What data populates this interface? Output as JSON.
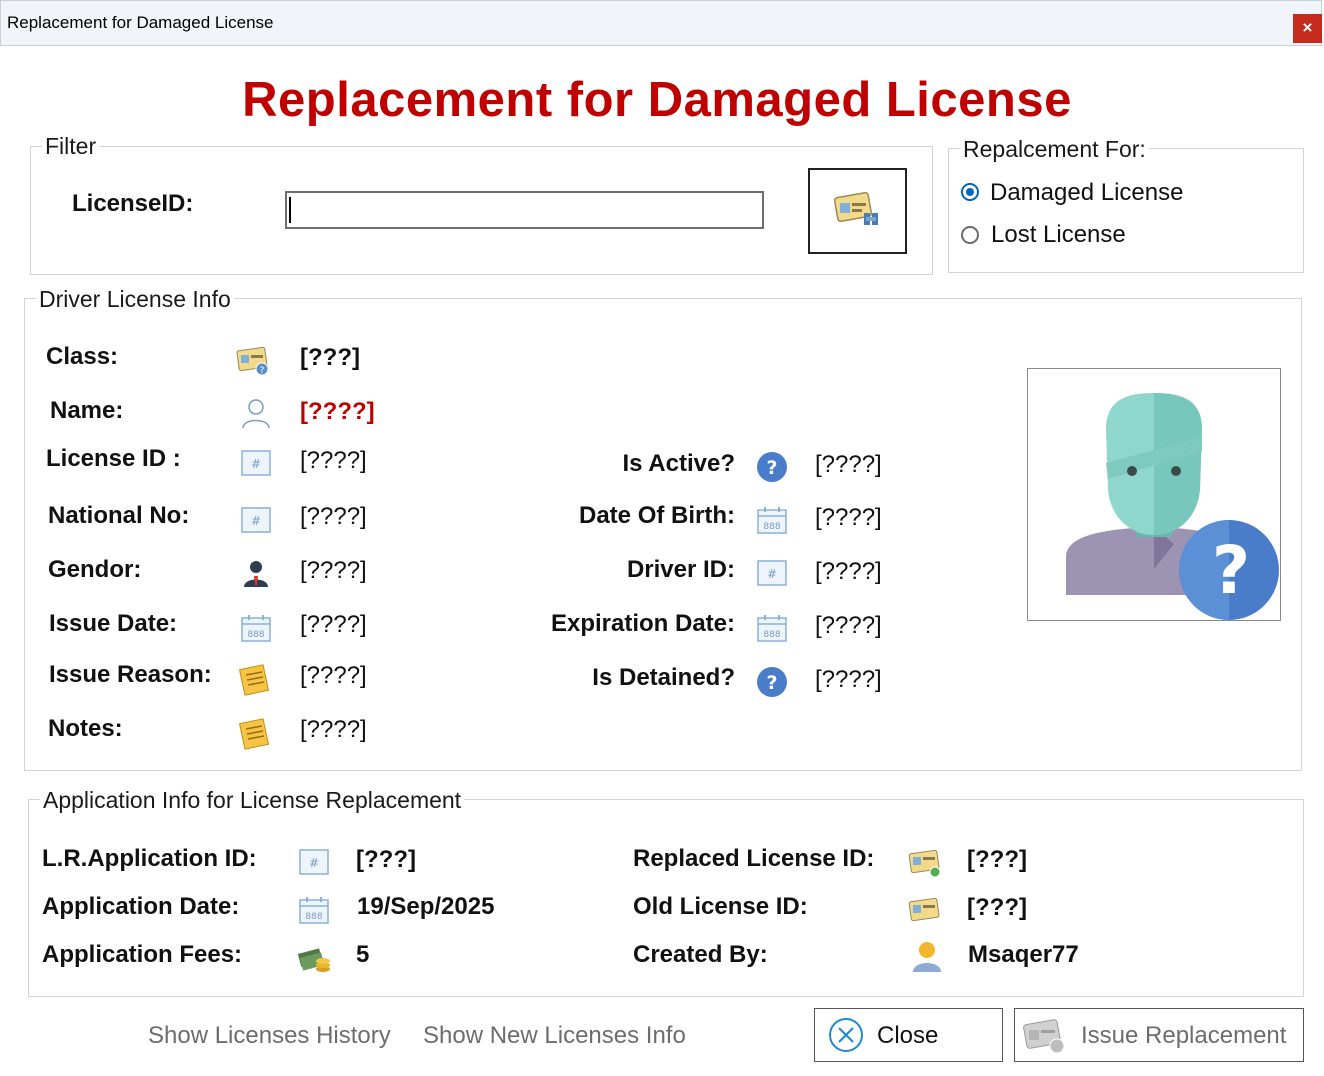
{
  "window": {
    "title": "Replacement for Damaged License",
    "close_glyph": "×"
  },
  "heading": "Replacement for Damaged License",
  "filter": {
    "legend": "Filter",
    "license_id_label": "LicenseID:",
    "license_id_value": "",
    "search_icon": "license-card-search-icon"
  },
  "replacement_for": {
    "legend": "Repalcement For:",
    "options": [
      {
        "label": "Damaged License",
        "selected": true
      },
      {
        "label": "Lost License",
        "selected": false
      }
    ]
  },
  "driver_info": {
    "legend": "Driver License Info",
    "left_rows": [
      {
        "label": "Class:",
        "icon": "license-class-icon",
        "value": "[???]"
      },
      {
        "label": "Name:",
        "icon": "person-outline-icon",
        "value": "[????]"
      },
      {
        "label": "License ID :",
        "icon": "id-number-icon",
        "value": "[????]"
      },
      {
        "label": "National No:",
        "icon": "id-number-icon",
        "value": "[????]"
      },
      {
        "label": "Gendor:",
        "icon": "gender-person-icon",
        "value": "[????]"
      },
      {
        "label": "Issue Date:",
        "icon": "calendar-icon",
        "value": "[????]"
      },
      {
        "label": "Issue Reason:",
        "icon": "notepad-icon",
        "value": "[????]"
      },
      {
        "label": "Notes:",
        "icon": "notepad-icon",
        "value": "[????]"
      }
    ],
    "right_rows": [
      {
        "label": "Is Active?",
        "icon": "question-circle-icon",
        "value": "[????]"
      },
      {
        "label": "Date Of Birth:",
        "icon": "calendar-icon",
        "value": "[????]"
      },
      {
        "label": "Driver ID:",
        "icon": "id-number-icon",
        "value": "[????]"
      },
      {
        "label": "Expiration Date:",
        "icon": "calendar-icon",
        "value": "[????]"
      },
      {
        "label": "Is Detained?",
        "icon": "question-circle-icon",
        "value": "[????]"
      }
    ],
    "photo_icon": "unknown-person-photo-icon"
  },
  "application_info": {
    "legend": "Application Info for License Replacement",
    "left_rows": [
      {
        "label": "L.R.Application ID:",
        "icon": "id-number-icon",
        "value": "[???]"
      },
      {
        "label": "Application Date:",
        "icon": "calendar-icon",
        "value": "19/Sep/2025"
      },
      {
        "label": "Application Fees:",
        "icon": "money-coins-icon",
        "value": "5"
      }
    ],
    "right_rows": [
      {
        "label": "Replaced License ID:",
        "icon": "license-card-new-icon",
        "value": "[???]"
      },
      {
        "label": "Old License ID:",
        "icon": "license-card-icon",
        "value": "[???]"
      },
      {
        "label": "Created By:",
        "icon": "user-avatar-icon",
        "value": "Msaqer77"
      }
    ]
  },
  "footer": {
    "show_history_link": "Show Licenses History",
    "show_new_info_link": "Show New Licenses Info",
    "close_button": "Close",
    "issue_button": "Issue Replacement"
  },
  "colors": {
    "title_red": "#c00000",
    "radio_blue": "#0067c0",
    "link_gray": "#6d6d6d"
  }
}
